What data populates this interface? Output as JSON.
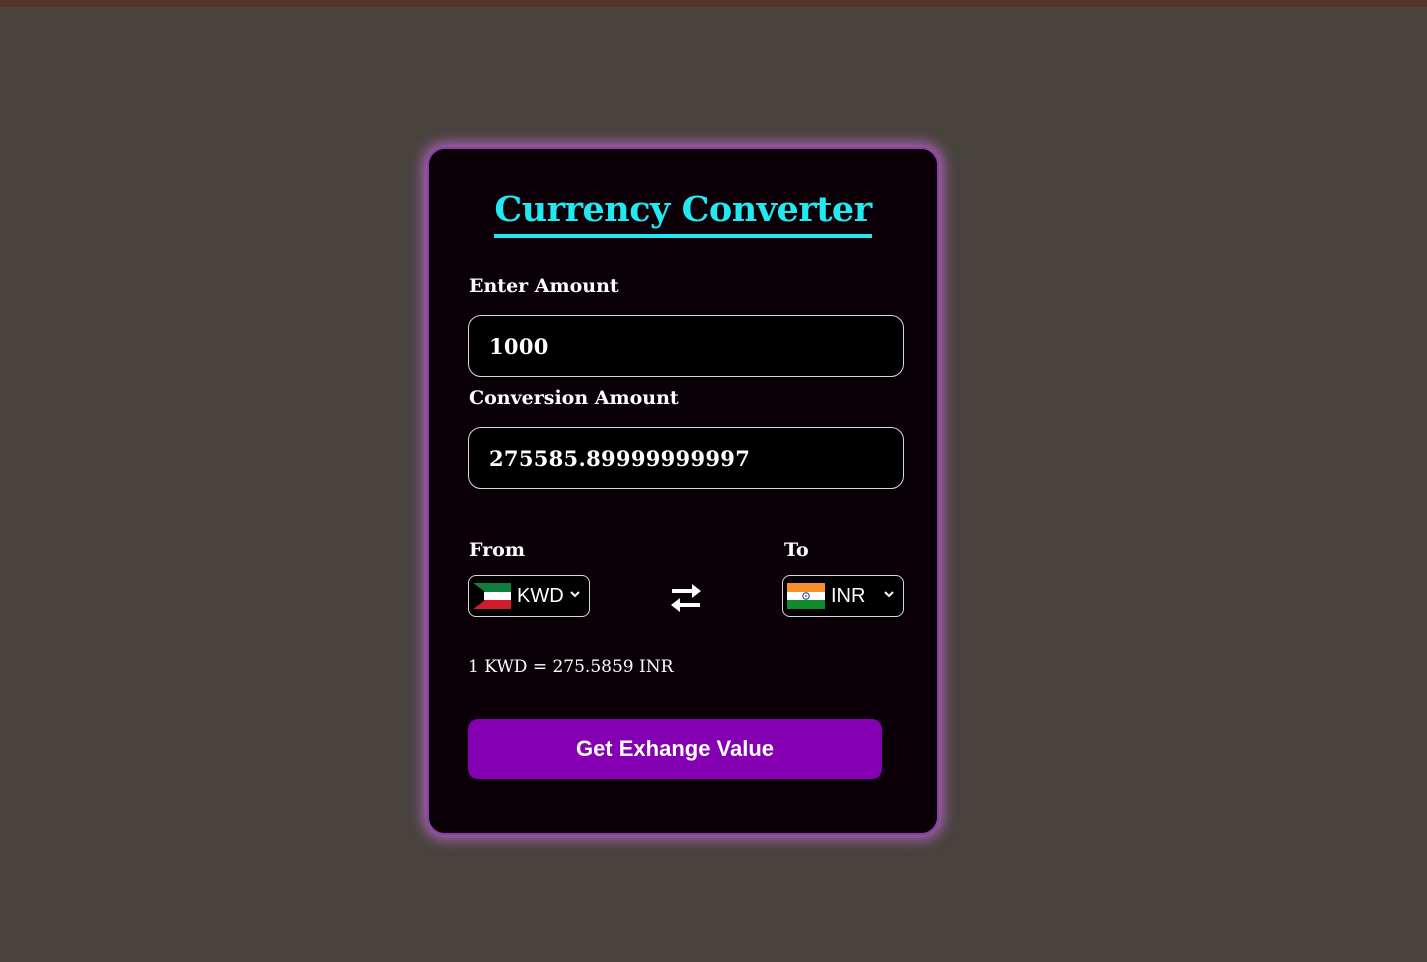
{
  "title": "Currency Converter",
  "amount": {
    "label": "Enter Amount",
    "value": "1000"
  },
  "conversion": {
    "label": "Conversion Amount",
    "value": "275585.89999999997"
  },
  "from": {
    "label": "From",
    "currency": "KWD",
    "flag": "kuwait-flag"
  },
  "to": {
    "label": "To",
    "currency": "INR",
    "flag": "india-flag"
  },
  "swap_icon": "swap-arrows-icon",
  "rate_text": "1 KWD = 275.5859 INR",
  "button_label": "Get Exhange Value",
  "colors": {
    "page_background": "#48433d",
    "card_background": "#0c0008",
    "card_glow": "#d26eeb",
    "title": "#22e8f0",
    "button": "#8500b2"
  }
}
